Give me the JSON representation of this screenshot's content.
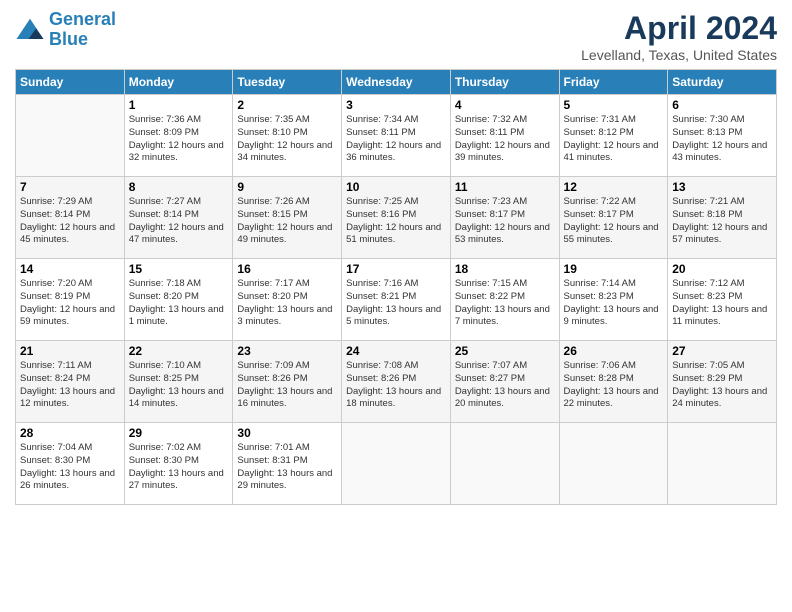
{
  "header": {
    "logo_line1": "General",
    "logo_line2": "Blue",
    "title": "April 2024",
    "location": "Levelland, Texas, United States"
  },
  "days_of_week": [
    "Sunday",
    "Monday",
    "Tuesday",
    "Wednesday",
    "Thursday",
    "Friday",
    "Saturday"
  ],
  "weeks": [
    [
      {
        "num": "",
        "sunrise": "",
        "sunset": "",
        "daylight": ""
      },
      {
        "num": "1",
        "sunrise": "Sunrise: 7:36 AM",
        "sunset": "Sunset: 8:09 PM",
        "daylight": "Daylight: 12 hours and 32 minutes."
      },
      {
        "num": "2",
        "sunrise": "Sunrise: 7:35 AM",
        "sunset": "Sunset: 8:10 PM",
        "daylight": "Daylight: 12 hours and 34 minutes."
      },
      {
        "num": "3",
        "sunrise": "Sunrise: 7:34 AM",
        "sunset": "Sunset: 8:11 PM",
        "daylight": "Daylight: 12 hours and 36 minutes."
      },
      {
        "num": "4",
        "sunrise": "Sunrise: 7:32 AM",
        "sunset": "Sunset: 8:11 PM",
        "daylight": "Daylight: 12 hours and 39 minutes."
      },
      {
        "num": "5",
        "sunrise": "Sunrise: 7:31 AM",
        "sunset": "Sunset: 8:12 PM",
        "daylight": "Daylight: 12 hours and 41 minutes."
      },
      {
        "num": "6",
        "sunrise": "Sunrise: 7:30 AM",
        "sunset": "Sunset: 8:13 PM",
        "daylight": "Daylight: 12 hours and 43 minutes."
      }
    ],
    [
      {
        "num": "7",
        "sunrise": "Sunrise: 7:29 AM",
        "sunset": "Sunset: 8:14 PM",
        "daylight": "Daylight: 12 hours and 45 minutes."
      },
      {
        "num": "8",
        "sunrise": "Sunrise: 7:27 AM",
        "sunset": "Sunset: 8:14 PM",
        "daylight": "Daylight: 12 hours and 47 minutes."
      },
      {
        "num": "9",
        "sunrise": "Sunrise: 7:26 AM",
        "sunset": "Sunset: 8:15 PM",
        "daylight": "Daylight: 12 hours and 49 minutes."
      },
      {
        "num": "10",
        "sunrise": "Sunrise: 7:25 AM",
        "sunset": "Sunset: 8:16 PM",
        "daylight": "Daylight: 12 hours and 51 minutes."
      },
      {
        "num": "11",
        "sunrise": "Sunrise: 7:23 AM",
        "sunset": "Sunset: 8:17 PM",
        "daylight": "Daylight: 12 hours and 53 minutes."
      },
      {
        "num": "12",
        "sunrise": "Sunrise: 7:22 AM",
        "sunset": "Sunset: 8:17 PM",
        "daylight": "Daylight: 12 hours and 55 minutes."
      },
      {
        "num": "13",
        "sunrise": "Sunrise: 7:21 AM",
        "sunset": "Sunset: 8:18 PM",
        "daylight": "Daylight: 12 hours and 57 minutes."
      }
    ],
    [
      {
        "num": "14",
        "sunrise": "Sunrise: 7:20 AM",
        "sunset": "Sunset: 8:19 PM",
        "daylight": "Daylight: 12 hours and 59 minutes."
      },
      {
        "num": "15",
        "sunrise": "Sunrise: 7:18 AM",
        "sunset": "Sunset: 8:20 PM",
        "daylight": "Daylight: 13 hours and 1 minute."
      },
      {
        "num": "16",
        "sunrise": "Sunrise: 7:17 AM",
        "sunset": "Sunset: 8:20 PM",
        "daylight": "Daylight: 13 hours and 3 minutes."
      },
      {
        "num": "17",
        "sunrise": "Sunrise: 7:16 AM",
        "sunset": "Sunset: 8:21 PM",
        "daylight": "Daylight: 13 hours and 5 minutes."
      },
      {
        "num": "18",
        "sunrise": "Sunrise: 7:15 AM",
        "sunset": "Sunset: 8:22 PM",
        "daylight": "Daylight: 13 hours and 7 minutes."
      },
      {
        "num": "19",
        "sunrise": "Sunrise: 7:14 AM",
        "sunset": "Sunset: 8:23 PM",
        "daylight": "Daylight: 13 hours and 9 minutes."
      },
      {
        "num": "20",
        "sunrise": "Sunrise: 7:12 AM",
        "sunset": "Sunset: 8:23 PM",
        "daylight": "Daylight: 13 hours and 11 minutes."
      }
    ],
    [
      {
        "num": "21",
        "sunrise": "Sunrise: 7:11 AM",
        "sunset": "Sunset: 8:24 PM",
        "daylight": "Daylight: 13 hours and 12 minutes."
      },
      {
        "num": "22",
        "sunrise": "Sunrise: 7:10 AM",
        "sunset": "Sunset: 8:25 PM",
        "daylight": "Daylight: 13 hours and 14 minutes."
      },
      {
        "num": "23",
        "sunrise": "Sunrise: 7:09 AM",
        "sunset": "Sunset: 8:26 PM",
        "daylight": "Daylight: 13 hours and 16 minutes."
      },
      {
        "num": "24",
        "sunrise": "Sunrise: 7:08 AM",
        "sunset": "Sunset: 8:26 PM",
        "daylight": "Daylight: 13 hours and 18 minutes."
      },
      {
        "num": "25",
        "sunrise": "Sunrise: 7:07 AM",
        "sunset": "Sunset: 8:27 PM",
        "daylight": "Daylight: 13 hours and 20 minutes."
      },
      {
        "num": "26",
        "sunrise": "Sunrise: 7:06 AM",
        "sunset": "Sunset: 8:28 PM",
        "daylight": "Daylight: 13 hours and 22 minutes."
      },
      {
        "num": "27",
        "sunrise": "Sunrise: 7:05 AM",
        "sunset": "Sunset: 8:29 PM",
        "daylight": "Daylight: 13 hours and 24 minutes."
      }
    ],
    [
      {
        "num": "28",
        "sunrise": "Sunrise: 7:04 AM",
        "sunset": "Sunset: 8:30 PM",
        "daylight": "Daylight: 13 hours and 26 minutes."
      },
      {
        "num": "29",
        "sunrise": "Sunrise: 7:02 AM",
        "sunset": "Sunset: 8:30 PM",
        "daylight": "Daylight: 13 hours and 27 minutes."
      },
      {
        "num": "30",
        "sunrise": "Sunrise: 7:01 AM",
        "sunset": "Sunset: 8:31 PM",
        "daylight": "Daylight: 13 hours and 29 minutes."
      },
      {
        "num": "",
        "sunrise": "",
        "sunset": "",
        "daylight": ""
      },
      {
        "num": "",
        "sunrise": "",
        "sunset": "",
        "daylight": ""
      },
      {
        "num": "",
        "sunrise": "",
        "sunset": "",
        "daylight": ""
      },
      {
        "num": "",
        "sunrise": "",
        "sunset": "",
        "daylight": ""
      }
    ]
  ]
}
